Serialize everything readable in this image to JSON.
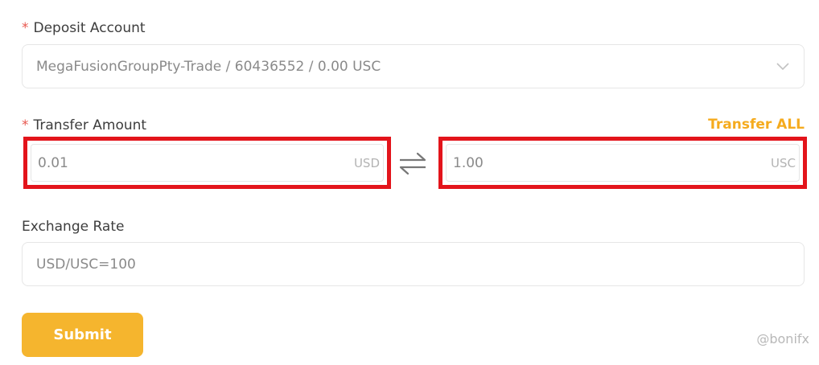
{
  "deposit_account": {
    "label": "Deposit Account",
    "required_marker": "*",
    "value": "MegaFusionGroupPty-Trade / 60436552 / 0.00 USC"
  },
  "transfer_amount": {
    "label": "Transfer Amount",
    "required_marker": "*",
    "transfer_all_label": "Transfer ALL",
    "from": {
      "value": "0.01",
      "currency": "USD"
    },
    "to": {
      "value": "1.00",
      "currency": "USC"
    }
  },
  "exchange_rate": {
    "label": "Exchange Rate",
    "value": "USD/USC=100"
  },
  "submit_label": "Submit",
  "watermark": "@bonifx",
  "colors": {
    "accent": "#f5b52e",
    "transfer_all": "#f5ab1e",
    "required": "#e8584f",
    "highlight": "#e3141b"
  },
  "icons": [
    "chevron-down-icon",
    "swap-arrows-icon"
  ]
}
